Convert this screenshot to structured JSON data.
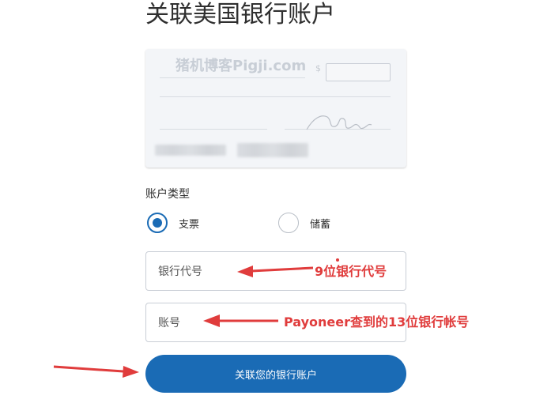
{
  "page": {
    "title": "关联美国银行账户"
  },
  "check_preview": {
    "watermark": "猪机博客Pigji.com",
    "currency_symbol": "$"
  },
  "account_type": {
    "label": "账户类型",
    "options": [
      {
        "label": "支票",
        "selected": true
      },
      {
        "label": "储蓄",
        "selected": false
      }
    ]
  },
  "fields": {
    "routing_number_placeholder": "银行代号",
    "account_number_placeholder": "账号"
  },
  "submit": {
    "label": "关联您的银行账户"
  },
  "annotations": {
    "routing_note": "9位银行代号",
    "account_note": "Payoneer查到的13位银行帐号"
  },
  "colors": {
    "primary": "#1a6bb5",
    "annotation": "#e03c3c"
  }
}
